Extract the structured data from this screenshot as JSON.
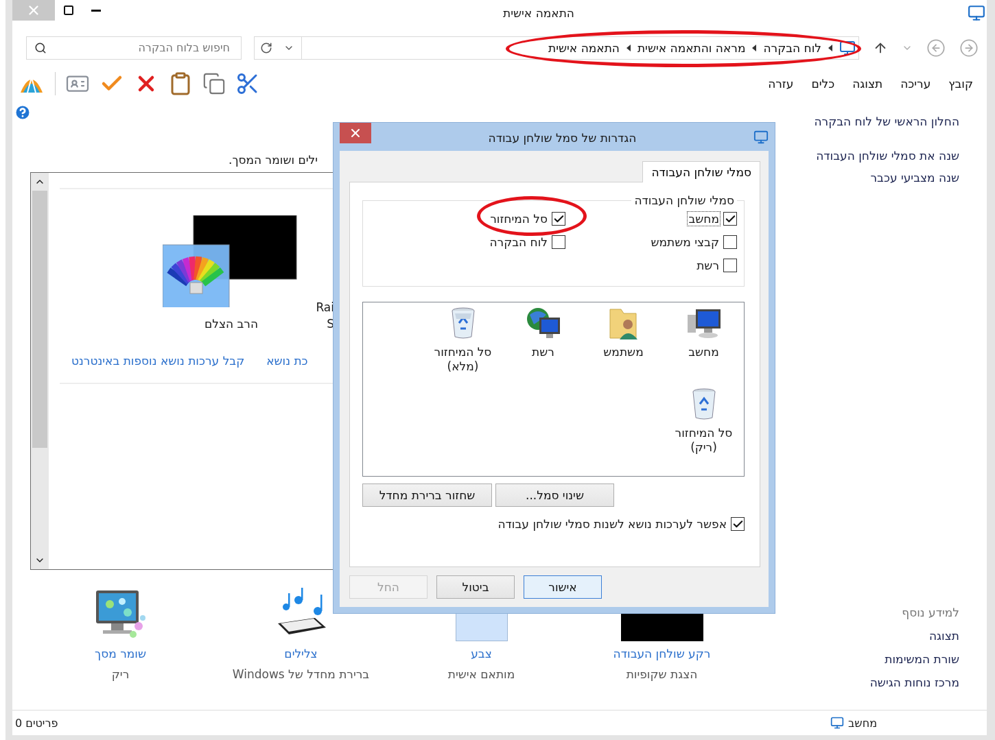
{
  "window": {
    "title": "התאמה אישית"
  },
  "address": {
    "crumbs": [
      "לוח הבקרה",
      "מראה והתאמה אישית",
      "התאמה אישית"
    ],
    "circled": true
  },
  "search": {
    "placeholder": "חיפוש בלוח הבקרה"
  },
  "menu": [
    "קובץ",
    "עריכה",
    "תצוגה",
    "כלים",
    "עזרה"
  ],
  "sidebar": {
    "links": [
      "החלון הראשי של לוח הבקרה",
      "שנה את סמלי שולחן העבודה",
      "שנה מצביעי עכבר"
    ],
    "see_also_title": "למידע נוסף",
    "see_also": [
      "תצוגה",
      "שורת המשימות",
      "מרכז נוחות הגישה"
    ]
  },
  "content": {
    "intro": "ילים ושומר המסך.",
    "themes": [
      {
        "lines": [
          "Rai",
          "S"
        ],
        "kind": "partial"
      },
      {
        "lines": [
          "הרב הצלם"
        ],
        "kind": "palette"
      }
    ],
    "links": [
      "כת נושא",
      "קבל ערכות נושא נוספות באינטרנט"
    ],
    "settings": [
      {
        "title": "רקע שולחן העבודה",
        "subtitle": "הצגת שקופיות",
        "kind": "background"
      },
      {
        "title": "צבע",
        "subtitle": "מותאם אישית",
        "kind": "color"
      },
      {
        "title": "צלילים",
        "subtitle": "ברירת מחדל של Windows",
        "kind": "sounds"
      },
      {
        "title": "שומר מסך",
        "subtitle": "ריק",
        "kind": "screensaver"
      }
    ]
  },
  "status_bar": {
    "items_count": "0 פריטים",
    "location": "מחשב"
  },
  "dialog": {
    "title": "הגדרות של סמל שולחן עבודה",
    "tabs": [
      {
        "label": "סמלי שולחן העבודה",
        "selected": true
      }
    ],
    "group_title": "סמלי שולחן העבודה",
    "checkboxes": [
      {
        "label": "מחשב",
        "checked": true,
        "focused": true,
        "circled": false
      },
      {
        "label": "סל המיחזור",
        "checked": true,
        "focused": false,
        "circled": true
      },
      {
        "label": "קבצי משתמש",
        "checked": false,
        "focused": false,
        "circled": false
      },
      {
        "label": "לוח הבקרה",
        "checked": false,
        "focused": false,
        "circled": false
      },
      {
        "label": "רשת",
        "checked": false,
        "focused": false,
        "circled": false
      }
    ],
    "icons": [
      {
        "lines": [
          "מחשב"
        ],
        "kind": "computer"
      },
      {
        "lines": [
          "משתמש"
        ],
        "kind": "user"
      },
      {
        "lines": [
          "רשת"
        ],
        "kind": "network"
      },
      {
        "lines": [
          "סל המיחזור",
          "(מלא)"
        ],
        "kind": "bin_full"
      },
      {
        "lines": [
          "סל המיחזור",
          "(ריק)"
        ],
        "kind": "bin_empty"
      }
    ],
    "actions": [
      "שינוי סמל...",
      "שחזור ברירת מחדל"
    ],
    "allow_themes": {
      "label": "אפשר לערכות נושא לשנות סמלי שולחן עבודה",
      "checked": true
    },
    "buttons": [
      {
        "label": "אישור",
        "default": true,
        "disabled": false
      },
      {
        "label": "ביטול",
        "default": false,
        "disabled": false
      },
      {
        "label": "החל",
        "default": false,
        "disabled": true
      }
    ]
  }
}
